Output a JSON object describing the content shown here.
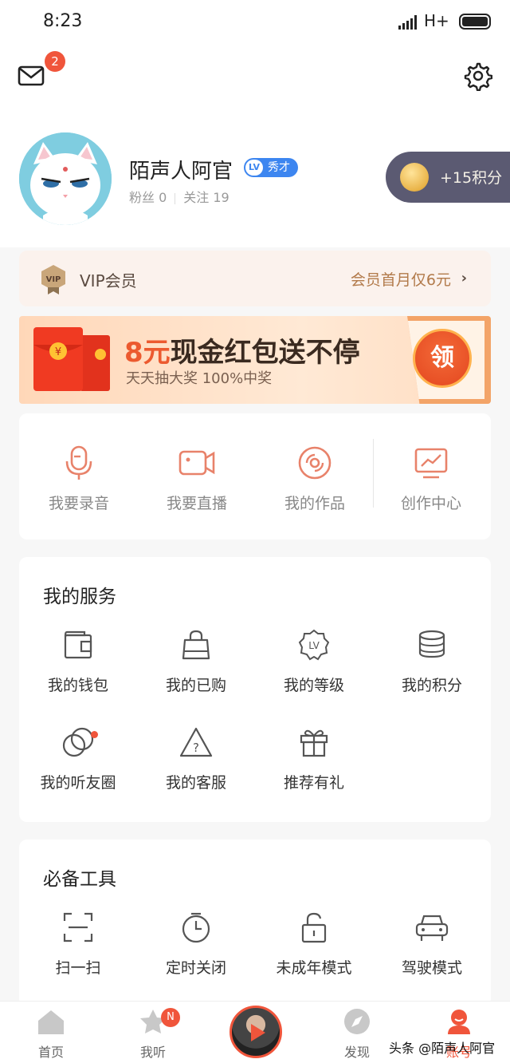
{
  "status_bar": {
    "time": "8:23",
    "network": "H+"
  },
  "header": {
    "mail_badge": "2",
    "user": {
      "name": "陌声人阿官",
      "level_icon": "LV",
      "level_title": "秀才",
      "fans": "粉丝 0",
      "following": "关注 19"
    },
    "points_reward": "+15积分"
  },
  "vip": {
    "badge": "VIP",
    "label": "VIP会员",
    "promo": "会员首月仅6元"
  },
  "banner": {
    "title_red": "8元",
    "title_rest": "现金红包送不停",
    "subtitle": "天天抽大奖 100%中奖",
    "claim": "领",
    "coin": "¥"
  },
  "quick_actions": [
    {
      "icon": "microphone-icon",
      "label": "我要录音"
    },
    {
      "icon": "video-camera-icon",
      "label": "我要直播"
    },
    {
      "icon": "disc-icon",
      "label": "我的作品"
    },
    {
      "icon": "monitor-chart-icon",
      "label": "创作中心"
    }
  ],
  "services": {
    "title": "我的服务",
    "items": [
      {
        "icon": "wallet-icon",
        "label": "我的钱包"
      },
      {
        "icon": "shopping-bag-icon",
        "label": "我的已购"
      },
      {
        "icon": "level-badge-icon",
        "label": "我的等级",
        "glyph": "LV"
      },
      {
        "icon": "coin-stack-icon",
        "label": "我的积分"
      },
      {
        "icon": "circles-icon",
        "label": "我的听友圈"
      },
      {
        "icon": "help-triangle-icon",
        "label": "我的客服",
        "glyph": "?"
      },
      {
        "icon": "gift-icon",
        "label": "推荐有礼"
      }
    ]
  },
  "tools": {
    "title": "必备工具",
    "items": [
      {
        "icon": "scan-icon",
        "label": "扫一扫"
      },
      {
        "icon": "timer-icon",
        "label": "定时关闭"
      },
      {
        "icon": "lock-icon",
        "label": "未成年模式"
      },
      {
        "icon": "car-icon",
        "label": "驾驶模式"
      }
    ]
  },
  "tab_bar": {
    "tabs": [
      {
        "icon": "home-icon",
        "label": "首页"
      },
      {
        "icon": "star-icon",
        "label": "我听",
        "badge": "N"
      },
      {
        "icon": "compass-icon",
        "label": "发现"
      },
      {
        "icon": "account-icon",
        "label": "账号"
      }
    ]
  },
  "watermark": "头条 @陌声人阿官"
}
